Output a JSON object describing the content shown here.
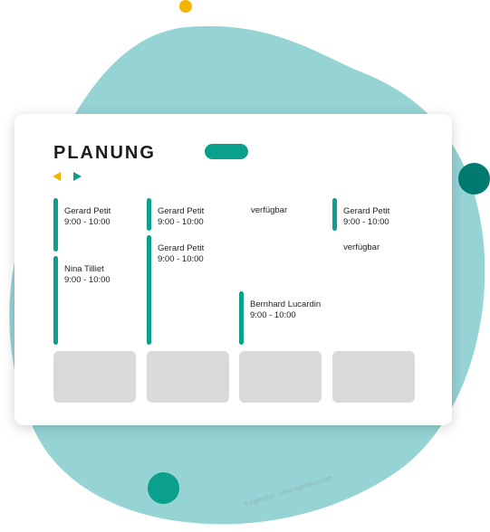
{
  "planner": {
    "title": "PLANUNG",
    "nav": {
      "prev_icon": "triangle-left-icon",
      "next_icon": "triangle-right-icon"
    },
    "appointments": [
      {
        "name": "Gerard Petit",
        "time": "9:00 - 10:00"
      },
      {
        "name": "Nina Tilliet",
        "time": "9:00 - 10:00"
      },
      {
        "name": "Gerard Petit",
        "time": "9:00 - 10:00"
      },
      {
        "name": "Gerard Petit",
        "time": "9:00 - 10:00"
      },
      {
        "name": "Bernhard Lucardin",
        "time": "9:00 - 10:00"
      },
      {
        "name": "Gerard Petit",
        "time": "9:00 - 10:00"
      }
    ],
    "available": [
      {
        "label": "verfügbar"
      },
      {
        "label": "verfügbar"
      }
    ]
  },
  "credit": "© Agendize - www.agendize.com",
  "colors": {
    "accent": "#0aa08b",
    "blob": "#96d3d5",
    "yellow": "#f4b400",
    "teal_dark": "#007a70",
    "placeholder_gray": "#d9d9d9"
  }
}
